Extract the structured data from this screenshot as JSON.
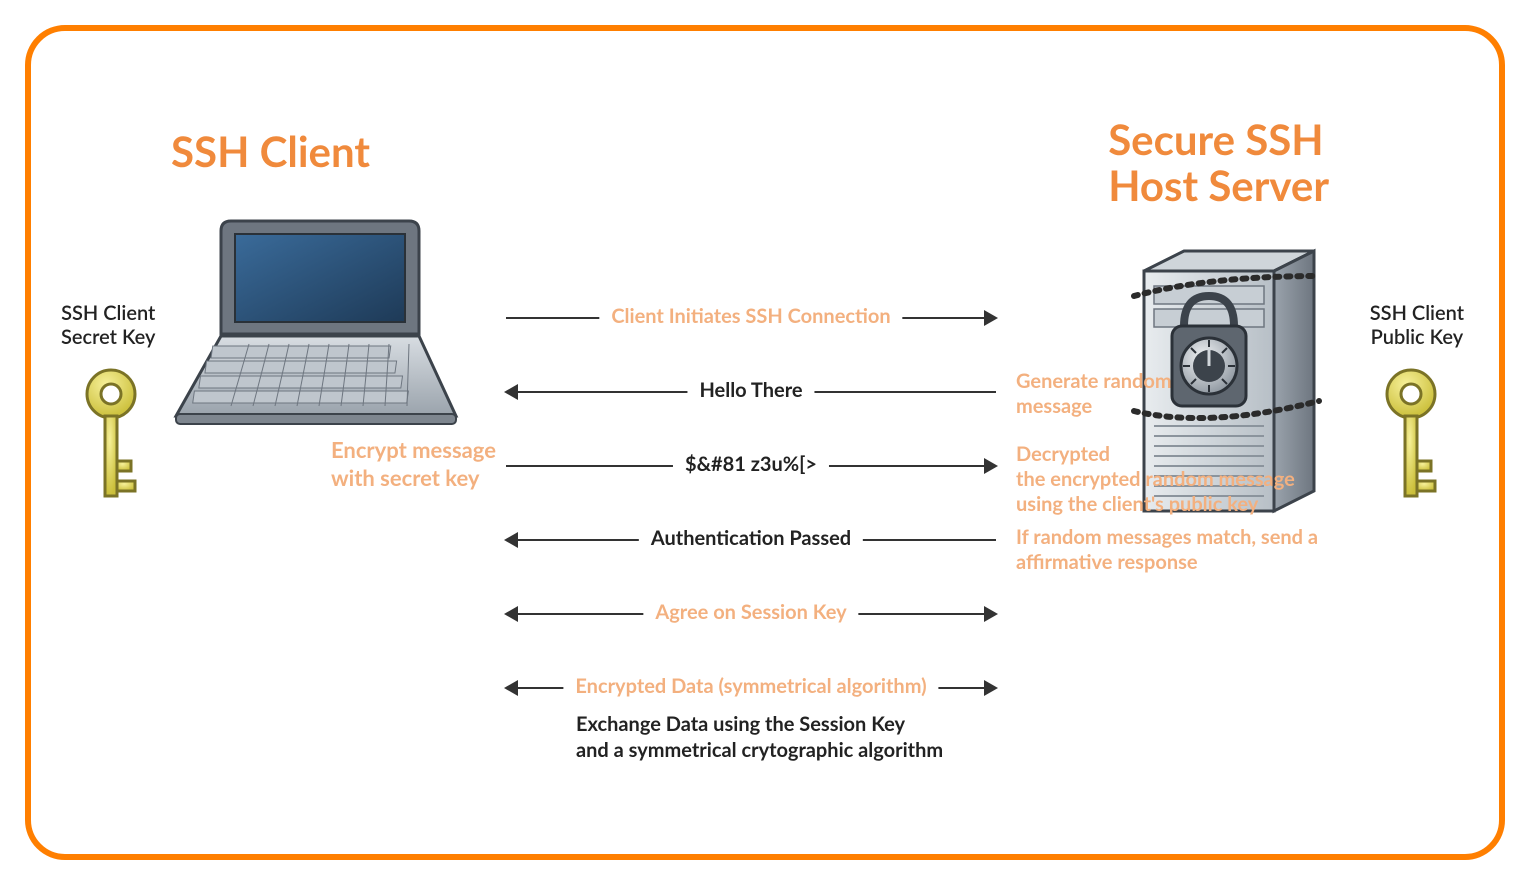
{
  "titles": {
    "client": "SSH Client",
    "server_l1": "Secure SSH",
    "server_l2": "Host Server"
  },
  "keys": {
    "secret_l1": "SSH Client",
    "secret_l2": "Secret Key",
    "public_l1": "SSH Client",
    "public_l2": "Public Key"
  },
  "client_note_l1": "Encrypt message",
  "client_note_l2": "with secret key",
  "server_notes": {
    "n1_l1": "Generate random",
    "n1_l2": "message",
    "n2_l1": "Decrypted",
    "n2_l2": "the encrypted random message",
    "n2_l3": "using the client's public key",
    "n3_l1": "If random messages match, send a",
    "n3_l2": "affirmative response"
  },
  "arrows": {
    "a1": "Client Initiates SSH Connection",
    "a2": "Hello There",
    "a3": "$&#81 z3u%[>",
    "a4": "Authentication Passed",
    "a5": "Agree on Session Key",
    "a6": "Encrypted Data (symmetrical algorithm)"
  },
  "footer_l1": "Exchange Data using the Session Key",
  "footer_l2": "and a symmetrical crytographic algorithm",
  "colors": {
    "accent_border": "#ff7f00",
    "heading": "#f08a3c",
    "light_orange": "#f3b07f",
    "text": "#222222"
  }
}
